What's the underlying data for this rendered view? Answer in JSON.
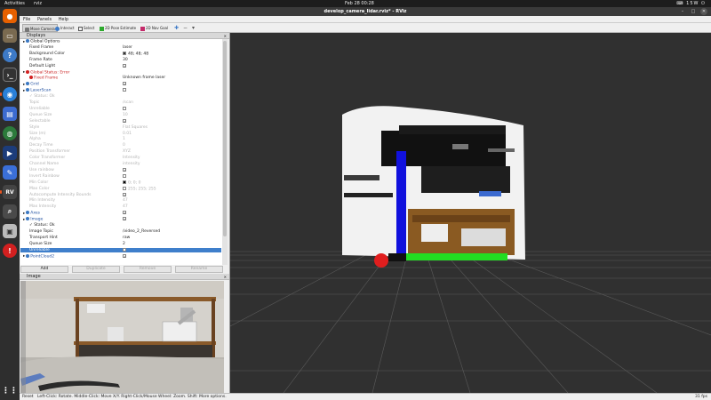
{
  "system": {
    "activities": "Activities",
    "app_name": "rviz",
    "clock": "Feb 28  00:28",
    "tray": "⌨ 15W  ⏻"
  },
  "window": {
    "title": "develop_camera_lidar.rviz* - RViz"
  },
  "menu": [
    "File",
    "Panels",
    "Help"
  ],
  "toolbar": [
    {
      "label": "Move Camera",
      "active": true
    },
    {
      "label": "Interact",
      "active": false
    },
    {
      "label": "Select",
      "active": false
    },
    {
      "label": "2D Pose Estimate",
      "active": false
    },
    {
      "label": "2D Nav Goal",
      "active": false
    }
  ],
  "displays": {
    "header": "Displays",
    "rows": [
      {
        "k": "Global Options",
        "v": "",
        "indent": 1,
        "kind": "group",
        "icon": "#3b78c2"
      },
      {
        "k": "Fixed Frame",
        "v": "laser",
        "indent": 2
      },
      {
        "k": "Background Color",
        "v": "48; 48; 48",
        "indent": 2,
        "swatch": "#303030"
      },
      {
        "k": "Frame Rate",
        "v": "30",
        "indent": 2
      },
      {
        "k": "Default Light",
        "v": "",
        "indent": 2,
        "check": true
      },
      {
        "k": "Global Status: Error",
        "v": "",
        "indent": 1,
        "kind": "error"
      },
      {
        "k": "Fixed Frame",
        "v": "Unknown frame laser",
        "indent": 2,
        "kind": "error"
      },
      {
        "k": "Grid",
        "v": "",
        "indent": 1,
        "kind": "display",
        "check": true
      },
      {
        "k": "LaserScan",
        "v": "",
        "indent": 1,
        "kind": "display",
        "check": false
      },
      {
        "k": "✓ Status: Ok",
        "v": "",
        "indent": 2,
        "dim": true
      },
      {
        "k": "Topic",
        "v": "/scan",
        "indent": 2,
        "dim": true
      },
      {
        "k": "Unreliable",
        "v": "",
        "indent": 2,
        "dim": true,
        "check": false
      },
      {
        "k": "Queue Size",
        "v": "10",
        "indent": 2,
        "dim": true
      },
      {
        "k": "Selectable",
        "v": "",
        "indent": 2,
        "dim": true,
        "check": true
      },
      {
        "k": "Style",
        "v": "Flat Squares",
        "indent": 2,
        "dim": true
      },
      {
        "k": "Size (m)",
        "v": "0.01",
        "indent": 2,
        "dim": true
      },
      {
        "k": "Alpha",
        "v": "1",
        "indent": 2,
        "dim": true
      },
      {
        "k": "Decay Time",
        "v": "0",
        "indent": 2,
        "dim": true
      },
      {
        "k": "Position Transformer",
        "v": "XYZ",
        "indent": 2,
        "dim": true
      },
      {
        "k": "Color Transformer",
        "v": "Intensity",
        "indent": 2,
        "dim": true
      },
      {
        "k": "Channel Name",
        "v": "intensity",
        "indent": 2,
        "dim": true
      },
      {
        "k": "Use rainbow",
        "v": "",
        "indent": 2,
        "dim": true,
        "check": true
      },
      {
        "k": "Invert Rainbow",
        "v": "",
        "indent": 2,
        "dim": true,
        "check": false
      },
      {
        "k": "Min Color",
        "v": "0; 0; 0",
        "indent": 2,
        "dim": true,
        "swatch": "#000000"
      },
      {
        "k": "Max Color",
        "v": "255; 255; 255",
        "indent": 2,
        "dim": true,
        "swatch": "#ffffff"
      },
      {
        "k": "Autocompute Intensity Bounds",
        "v": "",
        "indent": 2,
        "dim": true,
        "check": true
      },
      {
        "k": "Min Intensity",
        "v": "47",
        "indent": 2,
        "dim": true
      },
      {
        "k": "Max Intensity",
        "v": "47",
        "indent": 2,
        "dim": true
      },
      {
        "k": "Axes",
        "v": "",
        "indent": 1,
        "kind": "display",
        "check": true
      },
      {
        "k": "Image",
        "v": "",
        "indent": 1,
        "kind": "display",
        "check": true
      },
      {
        "k": "✓ Status: Ok",
        "v": "",
        "indent": 2
      },
      {
        "k": "Image Topic",
        "v": "/video_2_Reversed",
        "indent": 2
      },
      {
        "k": "Transport Hint",
        "v": "raw",
        "indent": 2
      },
      {
        "k": "Queue Size",
        "v": "2",
        "indent": 2
      },
      {
        "k": "Unreliable",
        "v": "",
        "indent": 2,
        "sel": true,
        "check": false
      },
      {
        "k": "PointCloud2",
        "v": "",
        "indent": 1,
        "kind": "display",
        "check": true
      }
    ],
    "buttons": [
      "Add",
      "Duplicate",
      "Remove",
      "Rename"
    ]
  },
  "image_panel": {
    "header": "Image"
  },
  "status": {
    "reset": "Reset",
    "hint": "Left-Click: Rotate. Middle-Click: Move X/Y. Right-Click/Mouse Wheel: Zoom. Shift: More options.",
    "fps": "31 fps"
  },
  "colors": {
    "grid": "#555555",
    "x_axis": "#22dd22",
    "y_axis": "#e01e1e",
    "z_axis": "#1111dd",
    "accent": "#e95420"
  }
}
